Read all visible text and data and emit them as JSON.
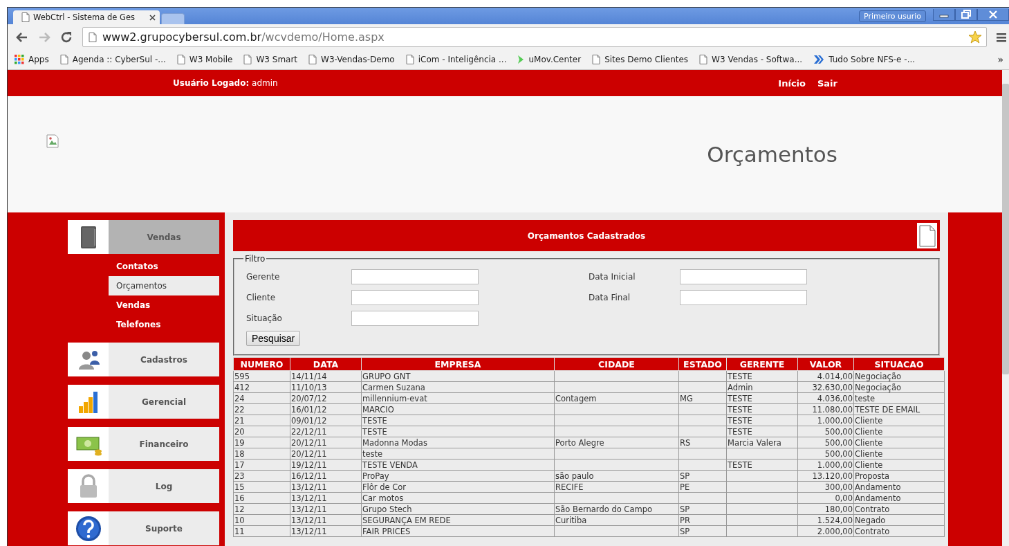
{
  "browser": {
    "tabs": [
      {
        "title": "WebCtrl - Sistema de Ges",
        "selected": true
      },
      {
        "selected": false
      }
    ],
    "profile": "Primeiro usurio",
    "address": {
      "host": "www2.grupocybersul.com.br",
      "path": "/wcvdemo/Home.aspx"
    },
    "bookmarks": [
      {
        "kind": "apps",
        "label": "Apps"
      },
      {
        "kind": "page",
        "label": "Agenda :: CyberSul -..."
      },
      {
        "kind": "page",
        "label": "W3 Mobile"
      },
      {
        "kind": "page",
        "label": "W3 Smart"
      },
      {
        "kind": "page",
        "label": "W3-Vendas-Demo"
      },
      {
        "kind": "page",
        "label": "iCom - Inteligência ..."
      },
      {
        "kind": "green",
        "label": "uMov.Center"
      },
      {
        "kind": "page",
        "label": "Sites Demo Clientes"
      },
      {
        "kind": "page",
        "label": "W3 Vendas - Softwa..."
      },
      {
        "kind": "blue",
        "label": "Tudo Sobre NFS-e -..."
      }
    ],
    "bookmarks_more": "»"
  },
  "header": {
    "user_label": "Usuário Logado:",
    "user_name": "admin",
    "links": [
      "Início",
      "Sair"
    ]
  },
  "page_title": "Orçamentos",
  "sidebar": [
    {
      "label": "Vendas",
      "kind": "tablet",
      "expanded": true,
      "children": [
        {
          "label": "Contatos",
          "selected": false
        },
        {
          "label": "Orçamentos",
          "selected": true
        },
        {
          "label": "Vendas",
          "selected": false
        },
        {
          "label": "Telefones",
          "selected": false
        }
      ]
    },
    {
      "label": "Cadastros",
      "kind": "users",
      "expanded": false
    },
    {
      "label": "Gerencial",
      "kind": "chart",
      "expanded": false
    },
    {
      "label": "Financeiro",
      "kind": "money",
      "expanded": false
    },
    {
      "label": "Log",
      "kind": "lock",
      "expanded": false
    },
    {
      "label": "Suporte",
      "kind": "help",
      "expanded": false
    }
  ],
  "panel": {
    "title": "Orçamentos Cadastrados",
    "filter": {
      "legend": "Filtro",
      "rows": [
        [
          {
            "label": "Gerente"
          },
          {
            "label": "Data Inicial"
          }
        ],
        [
          {
            "label": "Cliente"
          },
          {
            "label": "Data Final"
          }
        ],
        [
          {
            "label": "Situação"
          }
        ]
      ],
      "button": "Pesquisar"
    },
    "table": {
      "columns": [
        "NUMERO",
        "DATA",
        "EMPRESA",
        "CIDADE",
        "ESTADO",
        "GERENTE",
        "VALOR",
        "SITUACAO"
      ],
      "rows": [
        [
          "595",
          "14/11/14",
          "GRUPO GNT",
          "",
          "",
          "TESTE",
          "4.014,00",
          "Negociação"
        ],
        [
          "412",
          "11/10/13",
          "Carmen Suzana",
          "",
          "",
          "Admin",
          "32.630,00",
          "Negociação"
        ],
        [
          "24",
          "20/07/12",
          "millennium-evat",
          "Contagem",
          "MG",
          "TESTE",
          "4.036,00",
          "teste"
        ],
        [
          "22",
          "16/01/12",
          "MARCIO",
          "",
          "",
          "TESTE",
          "11.080,00",
          "TESTE DE EMAIL"
        ],
        [
          "21",
          "09/01/12",
          "TESTE",
          "",
          "",
          "TESTE",
          "1.000,00",
          "Cliente"
        ],
        [
          "20",
          "22/12/11",
          "TESTE",
          "",
          "",
          "TESTE",
          "500,00",
          "Cliente"
        ],
        [
          "19",
          "20/12/11",
          "Madonna Modas",
          "Porto Alegre",
          "RS",
          "Marcia Valera",
          "500,00",
          "Cliente"
        ],
        [
          "18",
          "20/12/11",
          "teste",
          "",
          "",
          "",
          "500,00",
          "Cliente"
        ],
        [
          "17",
          "19/12/11",
          "TESTE VENDA",
          "",
          "",
          "TESTE",
          "1.000,00",
          "Cliente"
        ],
        [
          "23",
          "16/12/11",
          "ProPay",
          "são paulo",
          "SP",
          "",
          "13.120,00",
          "Proposta"
        ],
        [
          "15",
          "13/12/11",
          "Flôr de Cor",
          "RECIFE",
          "PE",
          "",
          "300,00",
          "Andamento"
        ],
        [
          "16",
          "13/12/11",
          "Car motos",
          "",
          "",
          "",
          "0,00",
          "Andamento"
        ],
        [
          "12",
          "13/12/11",
          "Grupo Stech",
          "São Bernardo do Campo",
          "SP",
          "",
          "180,00",
          "Contrato"
        ],
        [
          "10",
          "13/12/11",
          "SEGURANÇA EM REDE",
          "Curitiba",
          "PR",
          "",
          "1.524,00",
          "Negado"
        ],
        [
          "11",
          "13/12/11",
          "FAIR PRICES",
          "",
          "SP",
          "",
          "2.000,00",
          "Contrato"
        ]
      ]
    }
  }
}
